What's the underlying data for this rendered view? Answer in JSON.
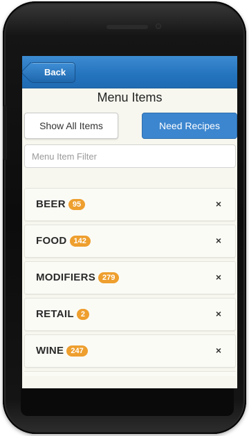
{
  "header": {
    "back_label": "Back"
  },
  "page": {
    "title": "Menu Items"
  },
  "actions": {
    "show_all_label": "Show All Items",
    "need_recipes_label": "Need Recipes"
  },
  "filter": {
    "placeholder": "Menu Item Filter",
    "value": ""
  },
  "categories": [
    {
      "label": "BEER",
      "count": "95"
    },
    {
      "label": "FOOD",
      "count": "142"
    },
    {
      "label": "MODIFIERS",
      "count": "279"
    },
    {
      "label": "RETAIL",
      "count": "2"
    },
    {
      "label": "WINE",
      "count": "247"
    }
  ],
  "remove_glyph": "×",
  "colors": {
    "header_blue": "#2373bd",
    "primary_button": "#3c86cf",
    "badge": "#ee9f2e",
    "screen_bg": "#f7f7ef"
  }
}
